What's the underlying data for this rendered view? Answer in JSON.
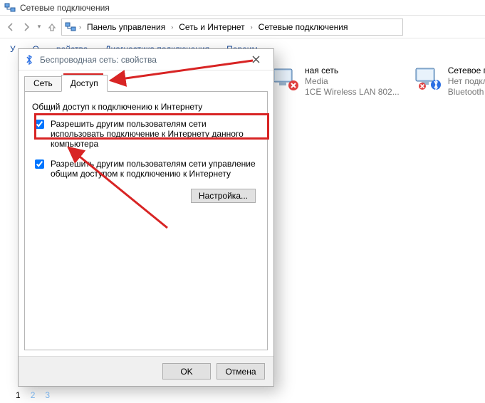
{
  "titlebar": {
    "title": "Сетевые подключения"
  },
  "breadcrumb": {
    "lvl1": "Панель управления",
    "lvl2": "Сеть и Интернет",
    "lvl3": "Сетевые подключения"
  },
  "toolbar": {
    "org": "У",
    "disable": "О",
    "diag_device": "ройства",
    "diag": "Диагностика подключения",
    "rename": "Переим"
  },
  "devices": {
    "d1": {
      "l1": "ная сеть",
      "l2": "Media",
      "l3": "1CE Wireless LAN 802..."
    },
    "d2": {
      "l1": "Сетевое подключен",
      "l2": "Нет подключения",
      "l3": "Bluetooth Device (P"
    }
  },
  "dialog": {
    "title": "Беспроводная сеть: свойства",
    "tabs": {
      "t1": "Сеть",
      "t2": "Доступ"
    },
    "section": "Общий доступ к подключению к Интернету",
    "opt1": "Разрешить другим пользователям сети использовать подключение к Интернету данного компьютера",
    "opt2": "Разрешить другим пользователям сети управление общим доступом к подключению к Интернету",
    "settings": "Настройка...",
    "ok": "OK",
    "cancel": "Отмена"
  },
  "pager": {
    "p1": "1",
    "p2": "2",
    "p3": "3"
  }
}
